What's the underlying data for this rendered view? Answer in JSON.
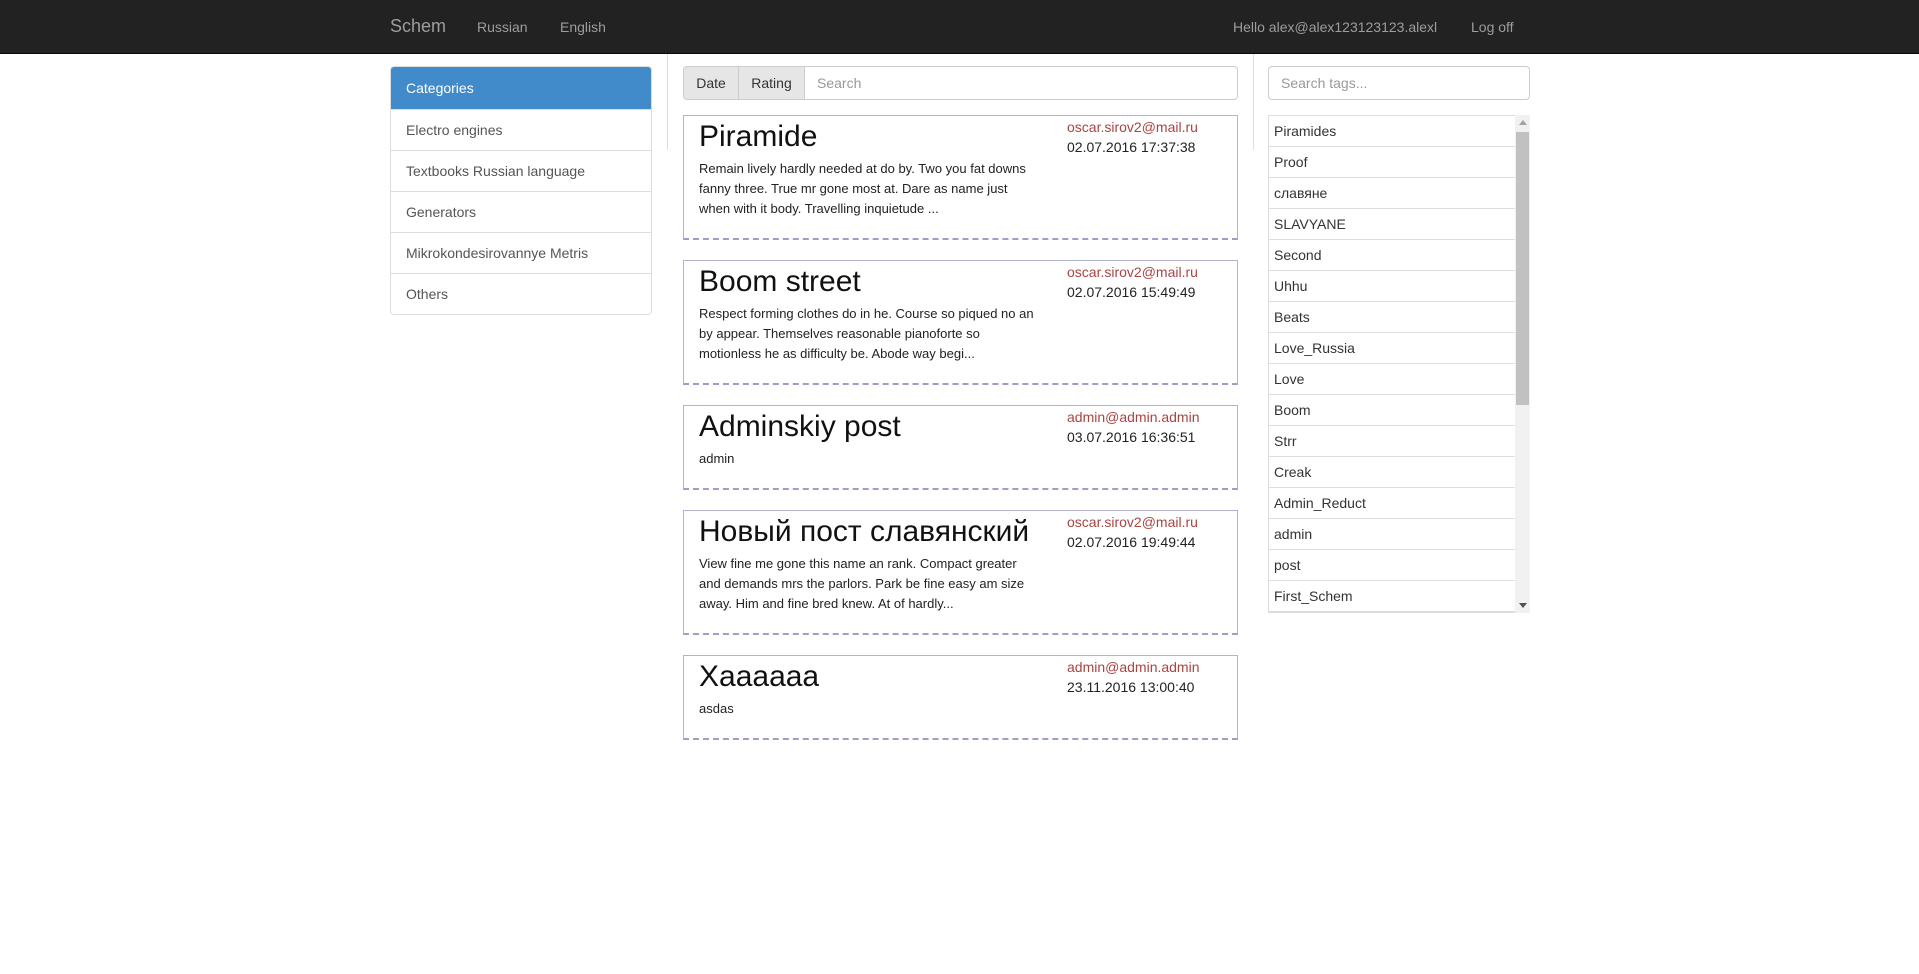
{
  "navbar": {
    "brand": "Schem",
    "lang_ru": "Russian",
    "lang_en": "English",
    "hello": "Hello alex@alex123123123.alexl",
    "logoff": "Log off"
  },
  "categories": {
    "header": "Categories",
    "items": [
      "Electro engines",
      "Textbooks Russian language",
      "Generators",
      "Mikrokondesirovannye Metris",
      "Others"
    ]
  },
  "sortbar": {
    "date_label": "Date",
    "rating_label": "Rating",
    "search_placeholder": "Search"
  },
  "posts": [
    {
      "title": "Piramide",
      "author": "oscar.sirov2@mail.ru",
      "date": "02.07.2016 17:37:38",
      "excerpt": "Remain lively hardly needed at do by. Two you fat downs fanny three. True mr gone most at. Dare as name just when with it body. Travelling inquietude ..."
    },
    {
      "title": "Boom street",
      "author": "oscar.sirov2@mail.ru",
      "date": "02.07.2016 15:49:49",
      "excerpt": "Respect forming clothes do in he. Course so piqued no an by appear. Themselves reasonable pianoforte so motionless he as difficulty be. Abode way begi..."
    },
    {
      "title": "Adminskiy post",
      "author": "admin@admin.admin",
      "date": "03.07.2016 16:36:51",
      "excerpt": "admin"
    },
    {
      "title": "Новый пост славянский",
      "author": "oscar.sirov2@mail.ru",
      "date": "02.07.2016 19:49:44",
      "excerpt": "View fine me gone this name an rank. Compact greater and demands mrs the parlors. Park be fine easy am size away. Him and fine bred knew. At of hardly..."
    },
    {
      "title": "Xaaaaaa",
      "author": "admin@admin.admin",
      "date": "23.11.2016 13:00:40",
      "excerpt": "asdas"
    }
  ],
  "tags": {
    "search_placeholder": "Search tags...",
    "items": [
      "Piramides",
      "Proof",
      "славяне",
      "SLAVYANE",
      "Second",
      "Uhhu",
      "Beats",
      "Love_Russia",
      "Love",
      "Boom",
      "Strr",
      "Creak",
      "Admin_Reduct",
      "admin",
      "post",
      "First_Schem"
    ]
  },
  "colors": {
    "navbar_bg": "#222222",
    "category_header_bg": "#428bca",
    "author_link": "#a94442",
    "post_border": "#b3b3d1"
  }
}
